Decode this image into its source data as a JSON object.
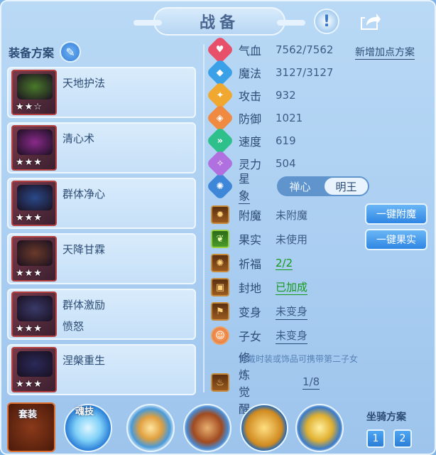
{
  "header": {
    "title": "战备",
    "help_icon": "help-icon",
    "share_icon": "share-icon"
  },
  "left": {
    "scheme_title": "装备方案",
    "edit_icon": "edit-icon",
    "skills": [
      {
        "name": "天地护法",
        "sub": "",
        "stars": "★★☆",
        "color": "#4a7a2a"
      },
      {
        "name": "清心术",
        "sub": "",
        "stars": "★★★",
        "color": "#8a2a8a"
      },
      {
        "name": "群体净心",
        "sub": "",
        "stars": "★★★",
        "color": "#2a4a8a"
      },
      {
        "name": "天降甘霖",
        "sub": "",
        "stars": "★★★",
        "color": "#6a3a2a"
      },
      {
        "name": "群体激励",
        "sub": "愤怒",
        "stars": "★★★",
        "color": "#3a3a6a"
      },
      {
        "name": "涅槃重生",
        "sub": "",
        "stars": "★★★",
        "color": "#2a2a5a"
      }
    ]
  },
  "stats": {
    "add_scheme": "新增加点方案",
    "rows": [
      {
        "label": "气血",
        "value": "7562/7562",
        "icon": "heart-icon",
        "color": "#e8506a",
        "glyph": "♥"
      },
      {
        "label": "魔法",
        "value": "3127/3127",
        "icon": "magic-icon",
        "color": "#3aa0e8",
        "glyph": "◆"
      },
      {
        "label": "攻击",
        "value": "932",
        "icon": "attack-icon",
        "color": "#f0a830",
        "glyph": "✦"
      },
      {
        "label": "防御",
        "value": "1021",
        "icon": "defense-icon",
        "color": "#f08a40",
        "glyph": "◈"
      },
      {
        "label": "速度",
        "value": "619",
        "icon": "speed-icon",
        "color": "#2ec08a",
        "glyph": "»"
      },
      {
        "label": "灵力",
        "value": "504",
        "icon": "spirit-icon",
        "color": "#b070e0",
        "glyph": "✧"
      }
    ],
    "star_label": "星象",
    "star_opts": [
      "禅心",
      "明王"
    ]
  },
  "extras": [
    {
      "label": "附魔",
      "value": "未附魔",
      "icon": "enchant-icon",
      "style": "plain",
      "glyph": "✹"
    },
    {
      "label": "果实",
      "value": "未使用",
      "icon": "fruit-icon",
      "style": "plain",
      "glyph": "❦"
    },
    {
      "label": "祈福",
      "value": "2/2",
      "icon": "blessing-icon",
      "style": "green",
      "glyph": "✺"
    },
    {
      "label": "封地",
      "value": "已加成",
      "icon": "fief-icon",
      "style": "green",
      "glyph": "▣"
    },
    {
      "label": "变身",
      "value": "未变身",
      "icon": "transform-icon",
      "style": "underline",
      "glyph": "⚑"
    },
    {
      "label": "子女",
      "value": "未变身",
      "icon": "child-icon",
      "style": "underline",
      "glyph": "☺"
    }
  ],
  "buttons": {
    "enchant": "一键附魔",
    "fruit": "一键果实"
  },
  "hint": "穿戴时装或饰品可携带第二子女",
  "cultivation": {
    "label": "修炼觉醒",
    "value": "1/8"
  },
  "bottom": {
    "suit_label": "套装",
    "soul_label": "魂技",
    "mount_label": "坐骑方案",
    "mount_1": "1",
    "mount_2": "2"
  }
}
